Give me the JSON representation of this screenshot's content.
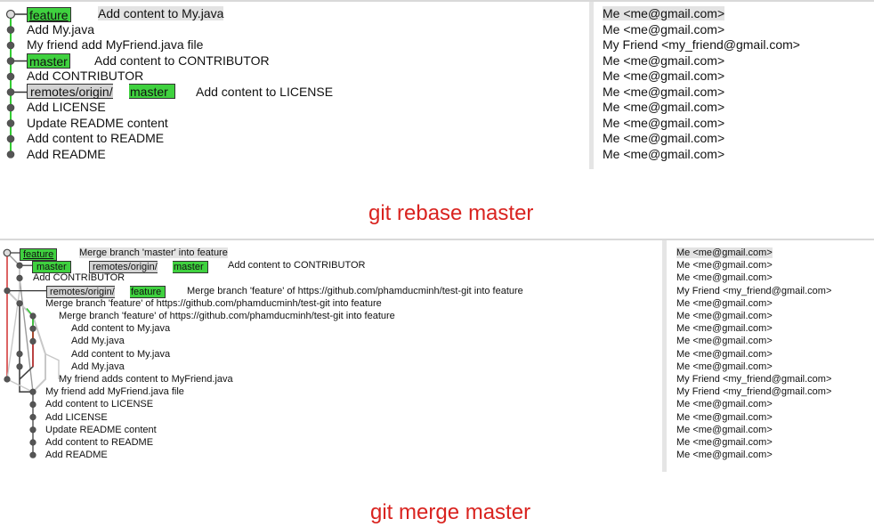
{
  "top": {
    "caption": "git rebase master",
    "refs": {
      "feature": "feature",
      "master": "master",
      "remote_prefix": "remotes/origin/",
      "remote_branch": "master"
    },
    "commits": [
      {
        "msg": "Add content to My.java",
        "author": "Me <me@gmail.com>"
      },
      {
        "msg": "Add My.java",
        "author": "Me <me@gmail.com>"
      },
      {
        "msg": "My friend add MyFriend.java file",
        "author": "My Friend <my_friend@gmail.com>"
      },
      {
        "msg": "Add content to CONTRIBUTOR",
        "author": "Me <me@gmail.com>"
      },
      {
        "msg": "Add CONTRIBUTOR",
        "author": "Me <me@gmail.com>"
      },
      {
        "msg": "Add content to LICENSE",
        "author": "Me <me@gmail.com>"
      },
      {
        "msg": "Add LICENSE",
        "author": "Me <me@gmail.com>"
      },
      {
        "msg": "Update README content",
        "author": "Me <me@gmail.com>"
      },
      {
        "msg": "Add content to README",
        "author": "Me <me@gmail.com>"
      },
      {
        "msg": "Add README",
        "author": "Me <me@gmail.com>"
      }
    ]
  },
  "bottom": {
    "caption": "git merge master",
    "refs": {
      "feature": "feature",
      "master": "master",
      "remote_prefix": "remotes/origin/",
      "remote_master": "master",
      "remote_feature": "feature"
    },
    "commits": [
      {
        "msg": "Merge branch 'master' into feature",
        "author": "Me <me@gmail.com>"
      },
      {
        "msg": "Add content to CONTRIBUTOR",
        "author": "Me <me@gmail.com>"
      },
      {
        "msg": "Add CONTRIBUTOR",
        "author": "Me <me@gmail.com>"
      },
      {
        "msg": "Merge branch 'feature' of https://github.com/phamducminh/test-git into feature",
        "author": "My Friend <my_friend@gmail.com>"
      },
      {
        "msg": "Merge branch 'feature' of https://github.com/phamducminh/test-git into feature",
        "author": "Me <me@gmail.com>"
      },
      {
        "msg": "Merge branch 'feature' of https://github.com/phamducminh/test-git into feature",
        "author": "Me <me@gmail.com>"
      },
      {
        "msg": "Add content to My.java",
        "author": "Me <me@gmail.com>"
      },
      {
        "msg": "Add My.java",
        "author": "Me <me@gmail.com>"
      },
      {
        "msg": "Add content to My.java",
        "author": "Me <me@gmail.com>"
      },
      {
        "msg": "Add My.java",
        "author": "Me <me@gmail.com>"
      },
      {
        "msg": "My friend adds content to MyFriend.java",
        "author": "My Friend <my_friend@gmail.com>"
      },
      {
        "msg": "My friend add MyFriend.java file",
        "author": "My Friend <my_friend@gmail.com>"
      },
      {
        "msg": "Add content to LICENSE",
        "author": "Me <me@gmail.com>"
      },
      {
        "msg": "Add LICENSE",
        "author": "Me <me@gmail.com>"
      },
      {
        "msg": "Update README content",
        "author": "Me <me@gmail.com>"
      },
      {
        "msg": "Add content to README",
        "author": "Me <me@gmail.com>"
      },
      {
        "msg": "Add README",
        "author": "Me <me@gmail.com>"
      }
    ]
  },
  "colors": {
    "branch_green": "#3fd13f",
    "ref_grey": "#d3d3d3",
    "caption_red": "#d9231f",
    "graph_dot": "#555555",
    "line_green": "#33cc33",
    "line_red": "#cc2222",
    "line_grey": "#9a9a9a",
    "line_lightgrey": "#c8c8c8"
  }
}
